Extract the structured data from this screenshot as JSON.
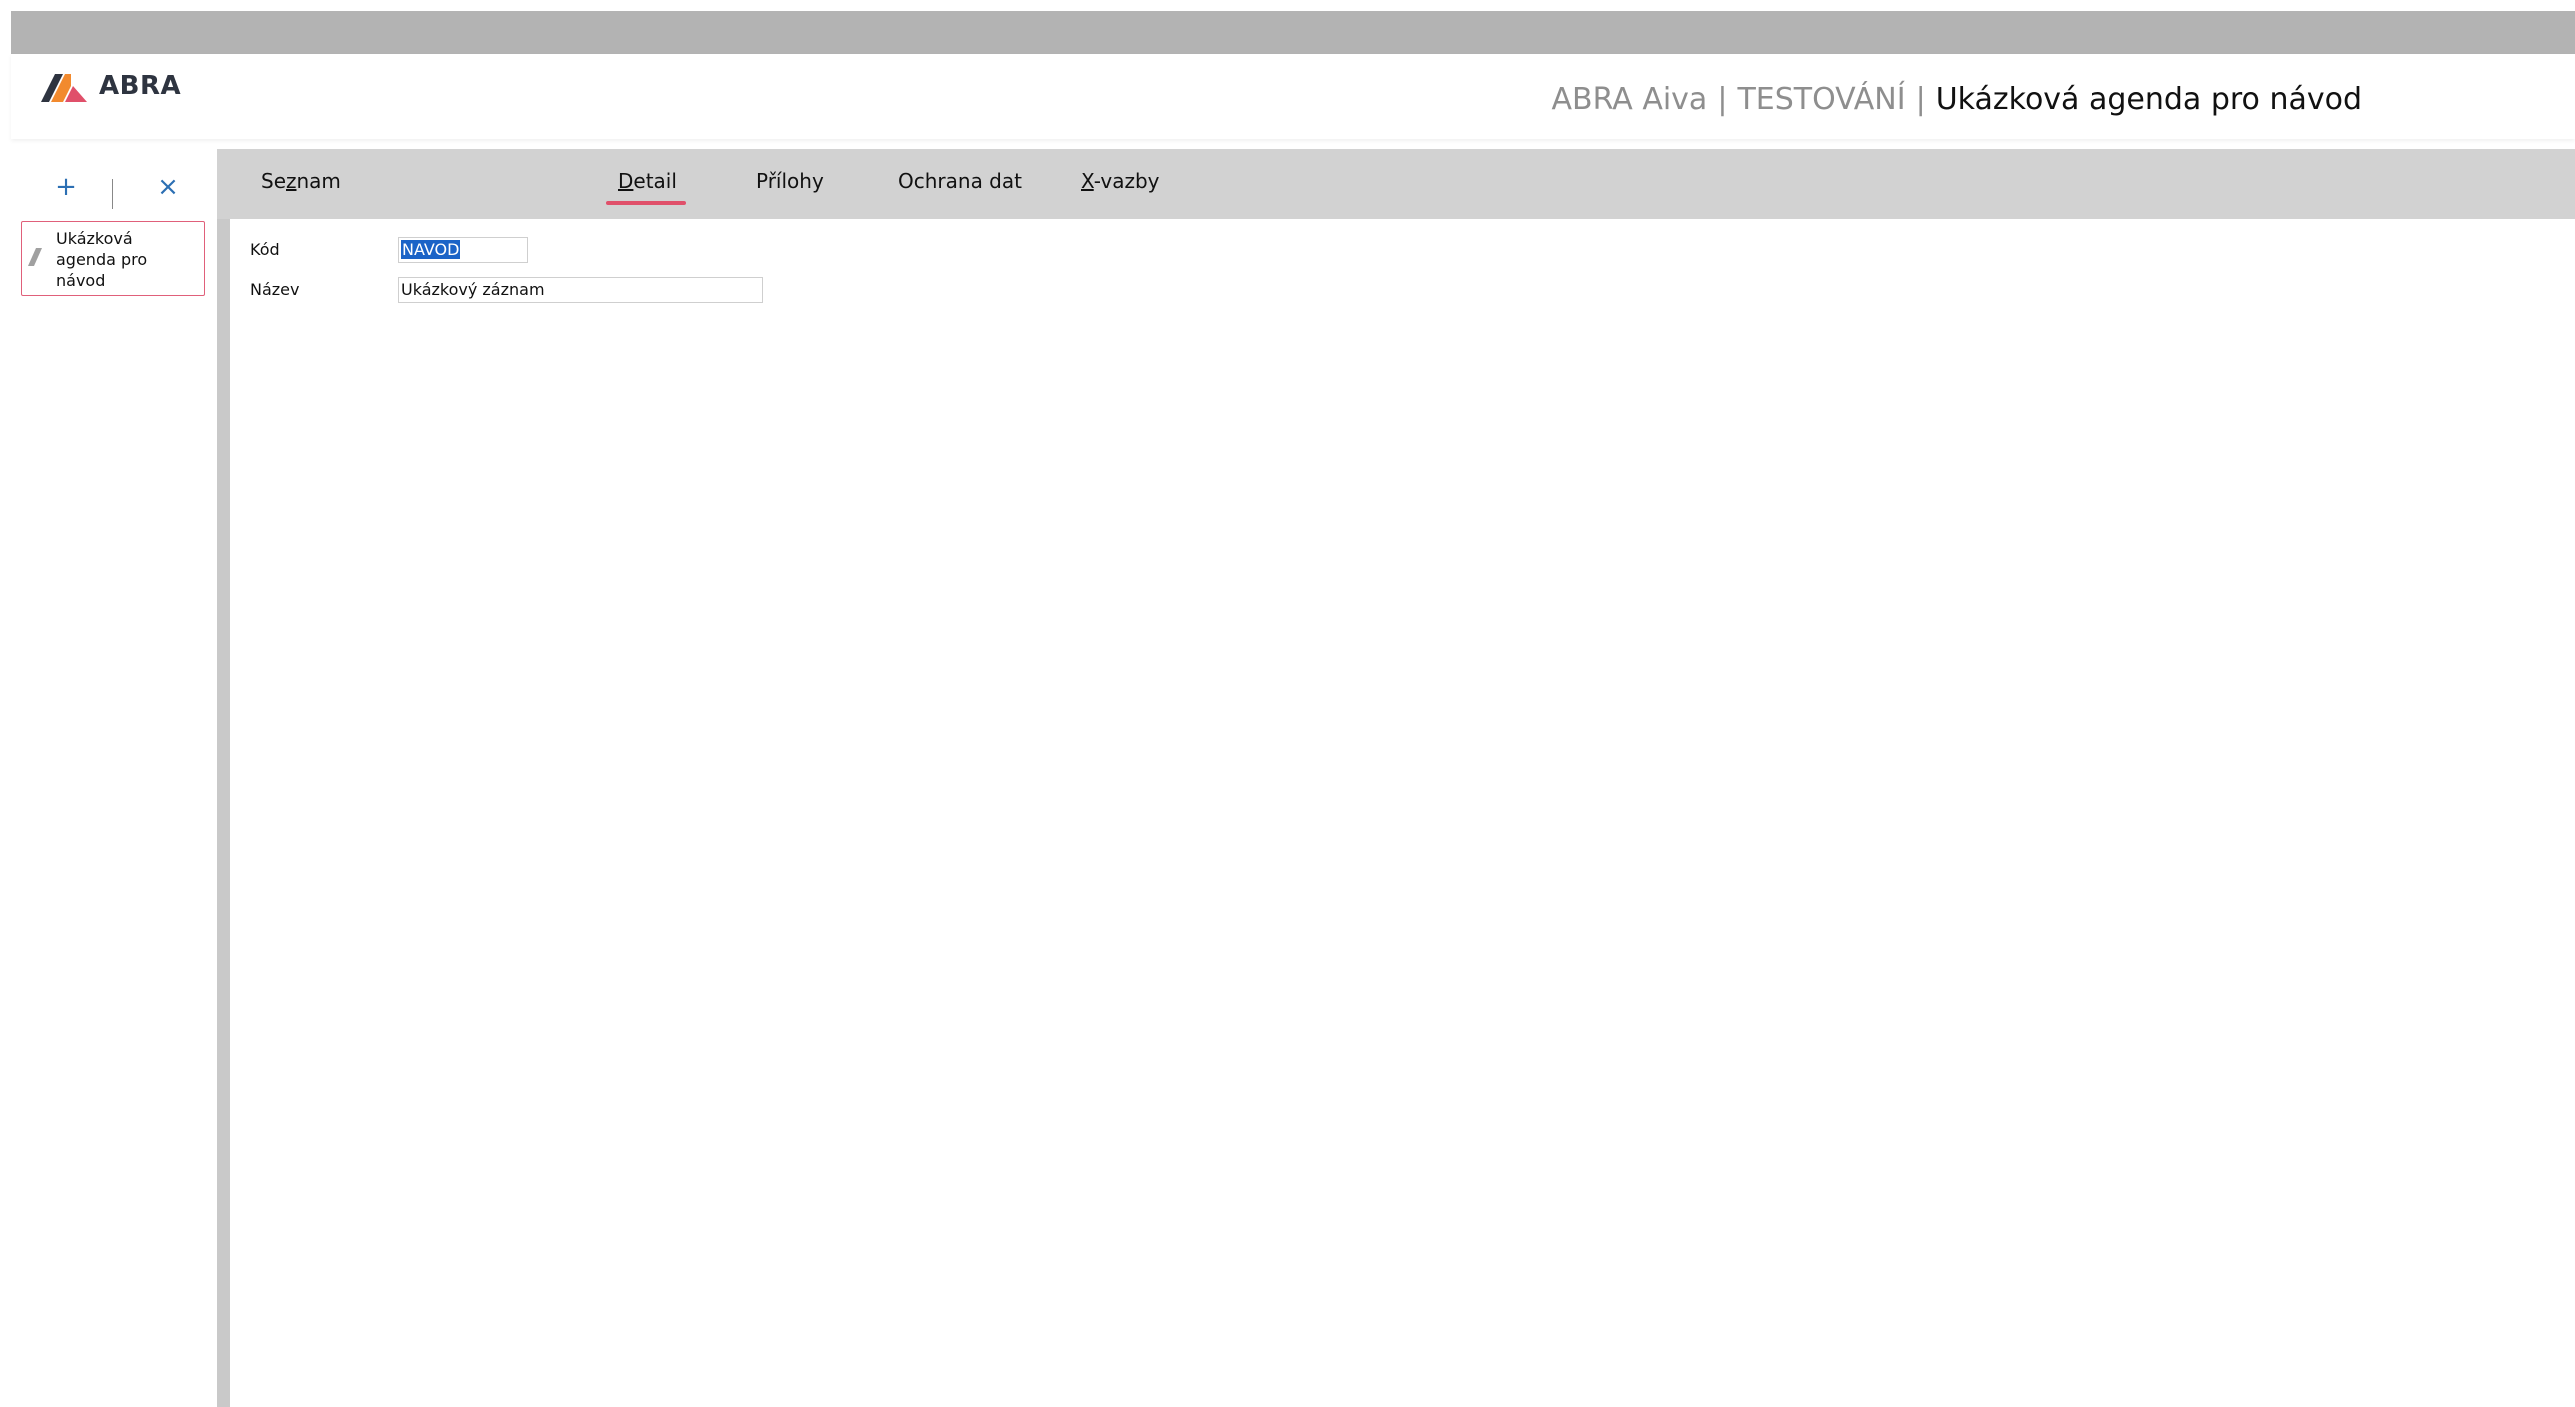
{
  "header": {
    "logo_text": "ABRA",
    "title_app": "ABRA Aiva",
    "title_sep1": "|",
    "title_env": "TESTOVÁNÍ",
    "title_sep2": "|",
    "title_agenda": "Ukázková agenda pro návod"
  },
  "panel": {
    "add_label": "+",
    "close_label": "×",
    "agenda_item": "Ukázková agenda pro návod"
  },
  "tabs": [
    {
      "pre": "Se",
      "ul": "z",
      "post": "nam"
    },
    {
      "pre": "",
      "ul": "D",
      "post": "etail"
    },
    {
      "pre": "Přílohy",
      "ul": "",
      "post": ""
    },
    {
      "pre": "Ochrana dat",
      "ul": "",
      "post": ""
    },
    {
      "pre": "",
      "ul": "X",
      "post": "-vazby"
    }
  ],
  "form": {
    "kod_label": "Kód",
    "kod_value": "NAVOD",
    "nazev_label": "Název",
    "nazev_value": "Ukázkový záznam"
  },
  "colors": {
    "accent": "#e0506a",
    "action_blue": "#2c6fb3",
    "selection": "#1a63c7"
  }
}
